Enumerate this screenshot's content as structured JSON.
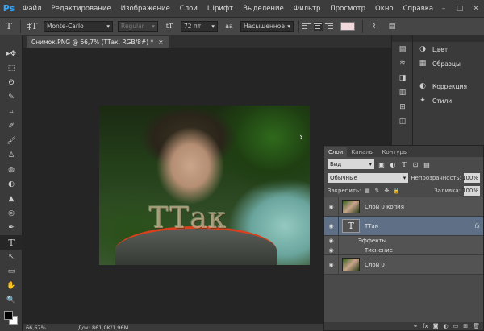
{
  "app": {
    "logo": "Ps"
  },
  "menu": [
    "Файл",
    "Редактирование",
    "Изображение",
    "Слои",
    "Шрифт",
    "Выделение",
    "Фильтр",
    "Просмотр",
    "Окно",
    "Справка"
  ],
  "window_controls": {
    "minimize": "–",
    "restore": "□",
    "close": "✕"
  },
  "options": {
    "tool_glyph": "T",
    "orient_glyph": "‡T",
    "font_family": "Monte-Carlo",
    "font_style": "Regular",
    "size_glyph": "tT",
    "font_size": "72 пт",
    "antialias_glyph": "aa",
    "antialias": "Насыщенное",
    "text_color": "#f0d8dc"
  },
  "document": {
    "tab_title": "Снимок.PNG @ 66,7% (TTак, RGB/8#) *",
    "close_glyph": "×",
    "canvas_text": "TTак",
    "arrow_glyph": "›"
  },
  "tools": [
    "▸✥",
    "⬚",
    "ʘ",
    "✎",
    "⌗",
    "✐",
    "🖌",
    "♙",
    "◍",
    "◐",
    "▲",
    "◎",
    "✒",
    "T",
    "↖",
    "▭",
    "✋",
    "🔍"
  ],
  "status": {
    "zoom": "66,67%",
    "doc": "Док: 861,0K/1,96M"
  },
  "dock_icons": [
    "▤",
    "≋",
    "◨",
    "▥",
    "⊞",
    "◫"
  ],
  "panels": [
    {
      "icon": "color-palette-icon",
      "glyph": "◑",
      "label": "Цвет"
    },
    {
      "icon": "swatches-icon",
      "glyph": "▦",
      "label": "Образцы"
    },
    {
      "icon": "adjustments-icon",
      "glyph": "◐",
      "label": "Коррекция"
    },
    {
      "icon": "styles-icon",
      "glyph": "✦",
      "label": "Стили"
    }
  ],
  "layers": {
    "tabs": [
      "Слои",
      "Каналы",
      "Контуры"
    ],
    "filter_kind": "Вид",
    "blend_mode": "Обычные",
    "opacity_label": "Непрозрачность:",
    "opacity": "100%",
    "lock_label": "Закрепить:",
    "fill_label": "Заливка:",
    "fill": "100%",
    "items": [
      {
        "name": "Слой 0 копия",
        "type": "image",
        "selected": false
      },
      {
        "name": "TTак",
        "type": "text",
        "selected": true,
        "fx": "fx",
        "thumb_glyph": "T"
      },
      {
        "name": "Эффекты",
        "type": "sub"
      },
      {
        "name": "Тиснение",
        "type": "sub"
      },
      {
        "name": "Слой 0",
        "type": "image",
        "selected": false
      }
    ],
    "footer": [
      "⚭",
      "fx",
      "◙",
      "◐",
      "▭",
      "⊞",
      "🗑"
    ]
  }
}
